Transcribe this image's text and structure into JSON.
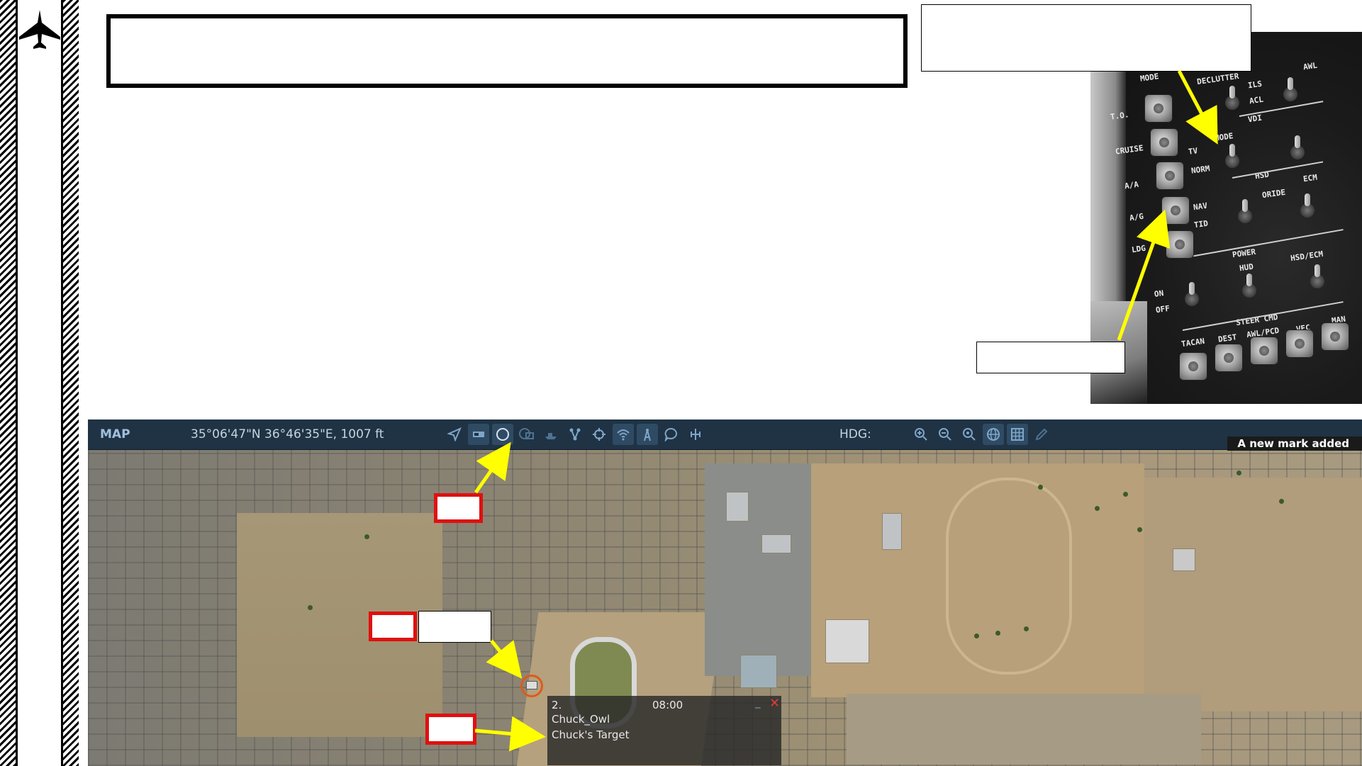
{
  "slide": {
    "title": "",
    "callout_top_right": "",
    "callout_panel": "",
    "callout_map_label": ""
  },
  "panel": {
    "labels": [
      "MODE",
      "DECLUTTER",
      "AWL",
      "T.O.",
      "CRUISE",
      "A/A",
      "A/G",
      "LDG",
      "ON",
      "OFF",
      "ILS",
      "ACL",
      "VDI",
      "MODE",
      "TV",
      "NORM",
      "HSD",
      "ECM",
      "NAV",
      "TID",
      "ORIDE",
      "POWER",
      "HUD",
      "HSD/ECM",
      "STEER CMD",
      "TACAN",
      "DEST",
      "AWL/PCD",
      "VEC",
      "MAN"
    ]
  },
  "map": {
    "title": "MAP",
    "coordinates": "35°06'47\"N 36°46'35\"E, 1007 ft",
    "hdg_label": "HDG:",
    "notice": "A new mark added",
    "toolbar_icons": [
      "navigate-icon",
      "marker-rectangle-icon",
      "circle-icon",
      "layers-icon",
      "ship-icon",
      "route-icon",
      "crosshair-icon",
      "wifi-icon",
      "antenna-icon",
      "chat-icon",
      "ruler-icon",
      "zoom-in-icon",
      "zoom-out-icon",
      "zoom-reset-icon",
      "globe-icon",
      "grid-icon",
      "pencil-icon"
    ],
    "popup": {
      "number": "2.",
      "time": "08:00",
      "author": "Chuck_Owl",
      "note": "Chuck's Target",
      "minimize": "_",
      "close": "✕"
    }
  },
  "colors": {
    "toolbar_bg": "#1f3344",
    "accent": "#9fc0dc",
    "callout_red": "#e01010",
    "arrow_yellow": "#ffff00",
    "mark_orange": "#e05a1a"
  }
}
